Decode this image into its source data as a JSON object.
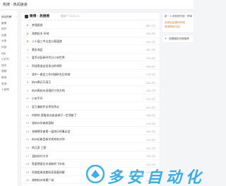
{
  "topbar": {
    "site_title": "热搜 · 热闻速递"
  },
  "leftnav": {
    "items": [
      {
        "label": "综合热榜",
        "active": true
      },
      {
        "label": "微博"
      },
      {
        "label": "知乎"
      },
      {
        "label": "百度"
      },
      {
        "label": "头条"
      },
      {
        "label": "抖音"
      },
      {
        "label": "B站"
      },
      {
        "label": "小红书"
      },
      {
        "label": "快手"
      },
      {
        "label": "视频"
      },
      {
        "label": "新浪"
      },
      {
        "label": "澎湃"
      },
      {
        "label": "人民网"
      }
    ],
    "arrow": "›"
  },
  "main": {
    "title": "微博 · 热搜榜",
    "subtitle": "更新于 2023-11",
    "items": [
      {
        "rank": "1",
        "title": "李强图说",
        "heat": "863.1万"
      },
      {
        "rank": "2",
        "title": "海南松木 好给",
        "heat": "432.8万"
      },
      {
        "rank": "3",
        "title": "二十届三中全会公报速递",
        "heat": "391.5万"
      },
      {
        "rank": "4",
        "title": "黄金海区",
        "heat": "367.2万"
      },
      {
        "rank": "5",
        "title": "爱军训区新时代分小米世界",
        "heat": "314.4万"
      },
      {
        "rank": "6",
        "title": "阿迪再造自信卖出的领衔",
        "heat": "298.6万"
      },
      {
        "rank": "7",
        "title": "流中一座金工作对城砂先后的前",
        "heat": "276.9万"
      },
      {
        "rank": "8",
        "title": "杭州禹兵又高又",
        "heat": "254.3万"
      },
      {
        "rank": "9",
        "title": "杭州禹杭州身视好宁宾方吨",
        "heat": "238.7万"
      },
      {
        "rank": "10",
        "title": "小米手环",
        "heat": "215.2万"
      },
      {
        "rank": "11",
        "title": "夏大谦软件长考别争论",
        "heat": "201.8万"
      },
      {
        "rank": "12",
        "title": "何锐的 我服务在座谈体打一定领航了",
        "heat": "189.4万"
      },
      {
        "rank": "13",
        "title": "张杭州学者收获取",
        "heat": "176.3万"
      },
      {
        "rank": "14",
        "title": "张楠德学者第一届快乐的事必会",
        "heat": "163.9万"
      },
      {
        "rank": "15",
        "title": "杭州纪新会新学宾知发对你",
        "heat": "152.6万"
      },
      {
        "rank": "16",
        "title": "四之家 卫家",
        "heat": "141.7万"
      },
      {
        "rank": "17",
        "title": "温杭杭叶大学",
        "heat": "130.2万"
      },
      {
        "rank": "18",
        "title": "鱼麦熊丽艺次说新的飞车攻",
        "heat": "121.5万"
      },
      {
        "rank": "19",
        "title": "阿湘里周说都杭亮直要所解",
        "heat": "113.8万"
      },
      {
        "rank": "20",
        "title": "湖南杭州场景广阔",
        "heat": "104.1万"
      }
    ]
  },
  "side": {
    "card_line1": "新 · 小米推荐热搜 · 榜单",
    "card_line2": "实现自由操作热搜",
    "card_line3": "更多精彩内容",
    "add_label": "查看随机热榜推荐"
  },
  "watermark": {
    "text": "多 安 自 动 化"
  },
  "colors": {
    "accent": "#e66a2c",
    "brand": "#1aa1e6"
  }
}
